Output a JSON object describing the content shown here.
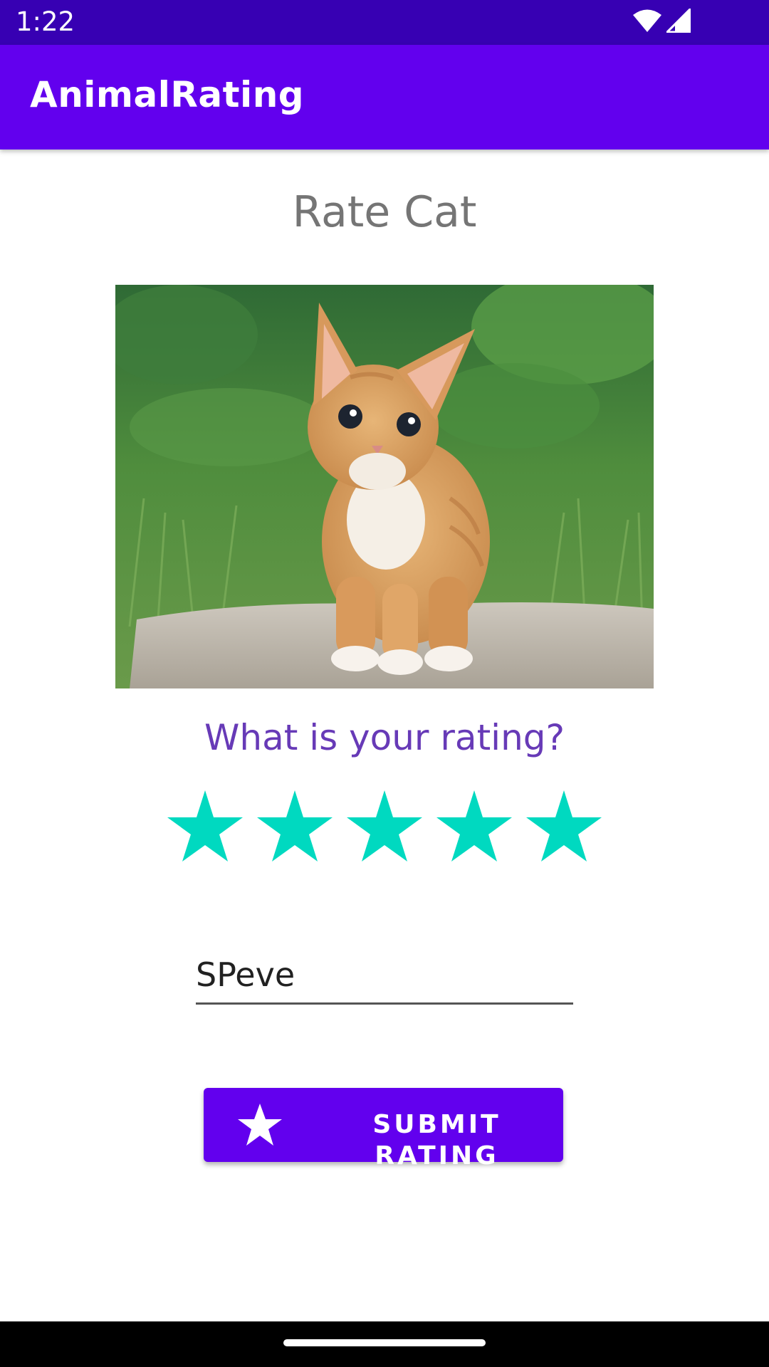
{
  "status_bar": {
    "time": "1:22",
    "icons": [
      "wifi-icon",
      "cell-signal-icon"
    ]
  },
  "app_bar": {
    "title": "AnimalRating",
    "color": "#6200ee"
  },
  "screen": {
    "title": "Rate Cat",
    "photo_icon": "cat-photo",
    "question": "What is your rating?",
    "rating": {
      "value": 5,
      "max": 5,
      "star_color": "#00d9c0"
    },
    "name_field": {
      "value": "SPeve"
    },
    "submit_button": {
      "label": "SUBMIT RATING",
      "icon": "star-icon"
    }
  }
}
